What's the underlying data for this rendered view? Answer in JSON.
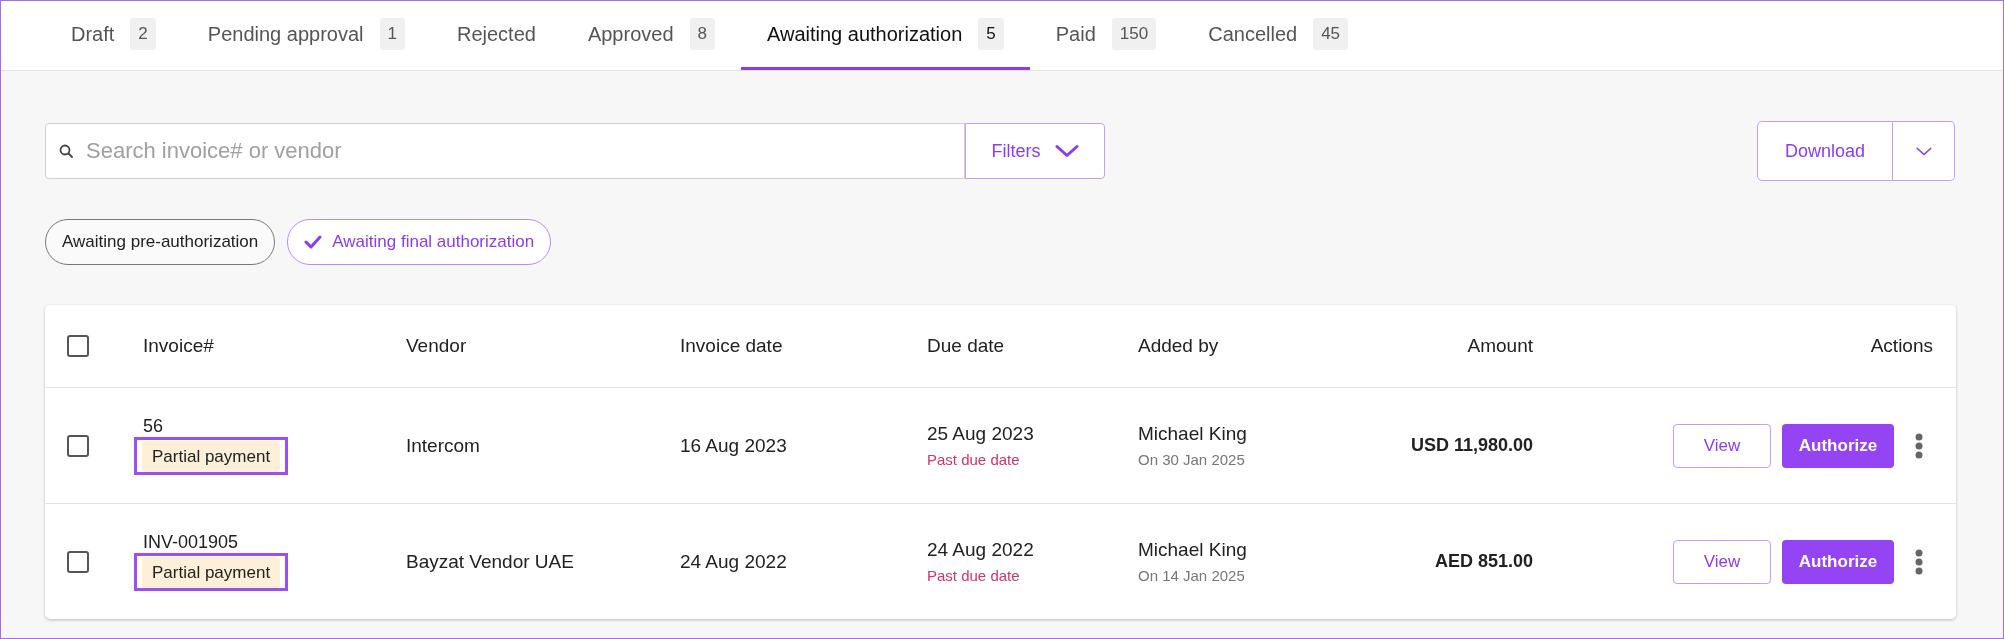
{
  "tabs": [
    {
      "label": "Draft",
      "count": "2",
      "selected": false
    },
    {
      "label": "Pending approval",
      "count": "1",
      "selected": false
    },
    {
      "label": "Rejected",
      "selected": false
    },
    {
      "label": "Approved",
      "count": "8",
      "selected": false
    },
    {
      "label": "Awaiting authorization",
      "count": "5",
      "selected": true
    },
    {
      "label": "Paid",
      "count": "150",
      "selected": false
    },
    {
      "label": "Cancelled",
      "count": "45",
      "selected": false
    }
  ],
  "search": {
    "placeholder": "Search invoice# or vendor"
  },
  "filters_button": "Filters",
  "download_button": "Download",
  "chips": [
    {
      "label": "Awaiting pre-authorization",
      "selected": false
    },
    {
      "label": "Awaiting final authorization",
      "selected": true
    }
  ],
  "table": {
    "select_all": {
      "checked": false
    },
    "columns": [
      "Invoice#",
      "Vendor",
      "Invoice date",
      "Due date",
      "Added by",
      "Amount",
      "Actions"
    ],
    "rows": [
      {
        "checked": false,
        "invoice": "56",
        "badge": "Partial payment",
        "highlighted": true,
        "vendor": "Intercom",
        "invoice_date": "16 Aug 2023",
        "due_date": "25 Aug 2023",
        "due_note": "Past due date",
        "added_by": "Michael King",
        "added_on": "On 30 Jan 2025",
        "amount": "USD 11,980.00",
        "actions": [
          "View",
          "Authorize"
        ]
      },
      {
        "checked": false,
        "invoice": "INV-001905",
        "badge": "Partial payment",
        "highlighted": true,
        "vendor": "Bayzat Vendor UAE",
        "invoice_date": "24 Aug 2022",
        "due_date": "24 Aug 2022",
        "due_note": "Past due date",
        "added_by": "Michael King",
        "added_on": "On 14 Jan 2025",
        "amount": "AED 851.00",
        "actions": [
          "View",
          "Authorize"
        ]
      }
    ]
  }
}
